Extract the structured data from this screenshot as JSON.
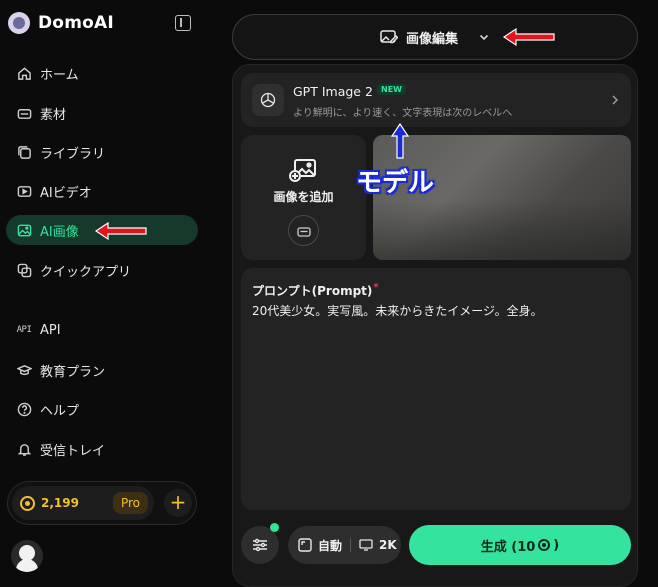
{
  "brand": {
    "name": "DomoAI"
  },
  "sidebar": {
    "items": [
      {
        "label": "ホーム",
        "icon": "home-icon"
      },
      {
        "label": "素材",
        "icon": "assets-icon"
      },
      {
        "label": "ライブラリ",
        "icon": "library-icon"
      },
      {
        "label": "AIビデオ",
        "icon": "video-icon"
      },
      {
        "label": "AI画像",
        "icon": "image-icon",
        "active": true
      },
      {
        "label": "クイックアプリ",
        "icon": "apps-icon"
      },
      {
        "label": "API",
        "icon": "api-icon",
        "icon_text": "API"
      },
      {
        "label": "教育プラン",
        "icon": "education-icon"
      },
      {
        "label": "ヘルプ",
        "icon": "help-icon"
      },
      {
        "label": "受信トレイ",
        "icon": "bell-icon"
      }
    ],
    "credits": "2,199",
    "pro_badge": "Pro",
    "add_button": "+"
  },
  "mode": {
    "label": "画像編集"
  },
  "model": {
    "name": "GPT Image 2",
    "badge": "NEW",
    "description": "より鮮明に、より速く、文字表現は次のレベルへ"
  },
  "upload": {
    "label": "画像を追加"
  },
  "prompt": {
    "label": "プロンプト(Prompt)",
    "required": "*",
    "text": "20代美少女。実写風。未来からきたイメージ。全身。"
  },
  "options": {
    "ratio": "自動",
    "resolution": "2K"
  },
  "generate": {
    "label_prefix": "生成 (10",
    "label_suffix": ")"
  },
  "annotation": {
    "label": "モデル",
    "color": "#1b2bd6",
    "arrow_red": "#e1141b"
  }
}
